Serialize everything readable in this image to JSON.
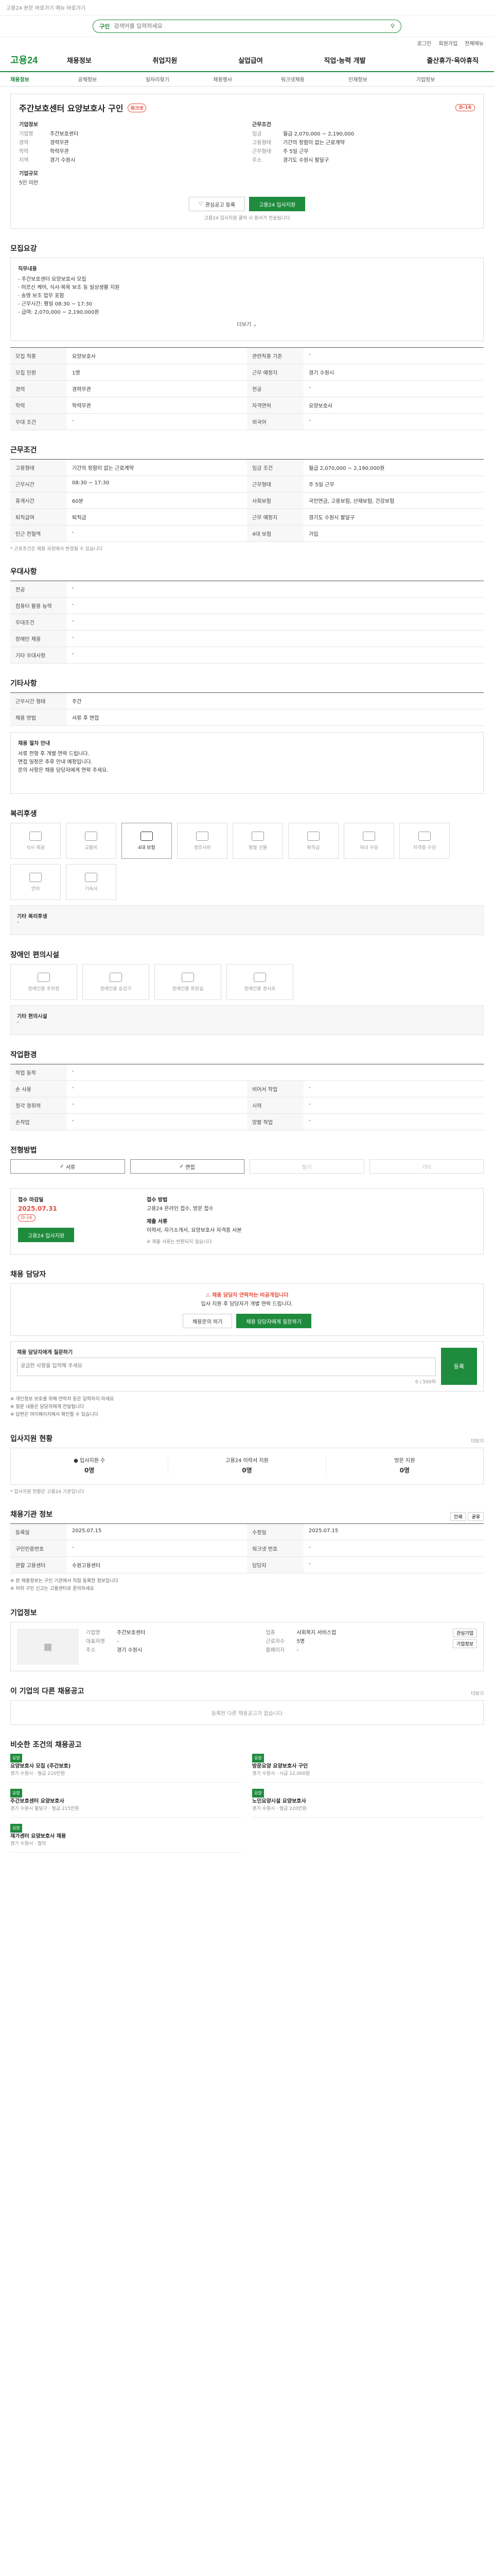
{
  "top": {
    "notice": "고용24 본문 바로가기 메뉴 바로가기"
  },
  "search": {
    "label": "구인",
    "placeholder": "검색어를 입력하세요"
  },
  "util": [
    "로그인",
    "회원가입",
    "전체메뉴"
  ],
  "brand": "고용24",
  "nav": [
    "채용정보",
    "취업지원",
    "실업급여",
    "직업·능력 개발",
    "출산휴가·육아휴직"
  ],
  "subnav": [
    "채용정보",
    "공채정보",
    "일자리찾기",
    "채용행사",
    "워크넷채용",
    "인재정보",
    "기업정보"
  ],
  "job": {
    "title": "주간보호센터 요양보호사 구인",
    "badge": "워크넷",
    "dday": "D-16",
    "company_label": "기업정보",
    "left": [
      [
        "기업명",
        "주간보호센터"
      ],
      [
        "경력",
        "경력무관"
      ],
      [
        "학력",
        "학력무관"
      ],
      [
        "지역",
        "경기 수원시"
      ]
    ],
    "right_label": "근무조건",
    "right": [
      [
        "임금",
        "월급 2,070,000 ~ 2,190,000"
      ],
      [
        "고용형태",
        "기간의 정함이 없는 근로계약"
      ],
      [
        "근무형태",
        "주 5일 근무"
      ],
      [
        "주소",
        "경기도 수원시 팔달구"
      ]
    ],
    "extra_label": "기업규모",
    "extra_value": "5인 미만",
    "btn_save": "관심공고 등록",
    "btn_apply": "고용24 입사지원",
    "note": "고용24 입사지원 클릭 시 원서가 전송됩니다"
  },
  "req": {
    "title": "모집요강",
    "duty_label": "직무내용",
    "duties": [
      "- 주간보호센터 요양보호사 모집",
      "· 어르신 케어, 식사·목욕 보조 등 일상생활 지원",
      "· 송영 보조 업무 포함",
      "- 근무시간: 평일 08:30 ~ 17:30",
      "- 급여: 2,070,000 ~ 2,190,000원"
    ],
    "more": "더보기",
    "rows": [
      [
        "모집 직종",
        "요양보호사",
        "관련직종 기준",
        "-"
      ],
      [
        "모집 인원",
        "1명",
        "근무 예정지",
        "경기 수원시"
      ],
      [
        "경력",
        "경력무관",
        "전공",
        "-"
      ],
      [
        "학력",
        "학력무관",
        "자격면허",
        "요양보호사"
      ],
      [
        "우대 조건",
        "-",
        "외국어",
        "-"
      ]
    ]
  },
  "work": {
    "title": "근무조건",
    "rows": [
      [
        "고용형태",
        "기간의 정함이 없는 근로계약",
        "임금 조건",
        "월급 2,070,000 ~ 2,190,000원"
      ],
      [
        "근무시간",
        "08:30 ~ 17:30",
        "근무형태",
        "주 5일 근무"
      ],
      [
        "휴게시간",
        "60분",
        "사회보험",
        "국민연금, 고용보험, 산재보험, 건강보험"
      ],
      [
        "퇴직급여",
        "퇴직금",
        "근무 예정지",
        "경기도 수원시 팔달구"
      ],
      [
        "인근 전철역",
        "-",
        "4대 보험",
        "가입"
      ]
    ],
    "note": "* 근로조건은 채용 과정에서 변경될 수 있습니다"
  },
  "welfare": {
    "title": "우대사항",
    "rows": [
      [
        "전공",
        "-"
      ],
      [
        "컴퓨터 활용 능력",
        "-"
      ],
      [
        "우대조건",
        "-"
      ],
      [
        "장애인 채용",
        "-"
      ],
      [
        "기타 우대사항",
        "-"
      ]
    ]
  },
  "process": {
    "title": "기타사항",
    "rows": [
      [
        "근무시간 형태",
        "주간"
      ],
      [
        "채용 방법",
        "서류 후 면접"
      ]
    ],
    "box_title": "채용 절차 안내",
    "box_lines": [
      "서류 전형 후 개별 연락 드립니다.",
      "면접 일정은 추후 안내 예정입니다.",
      "문의 사항은 채용 담당자에게 연락 주세요."
    ]
  },
  "benefits": {
    "title": "복리후생",
    "items": [
      "식사 제공",
      "교통비",
      "4대 보험",
      "경조사비",
      "명절 선물",
      "퇴직금",
      "자녀 수당",
      "자격증 수당",
      "연차",
      "기숙사"
    ],
    "active": [
      2
    ],
    "other_label": "기타 복리후생",
    "other_value": "-"
  },
  "disabled": {
    "title": "장애인 편의시설",
    "items": [
      "장애인용 주차장",
      "장애인용 승강기",
      "장애인용 화장실",
      "장애인용 경사로"
    ],
    "other_label": "기타 편의시설",
    "other_value": "-"
  },
  "env": {
    "title": "작업환경",
    "rows": [
      [
        "작업 동작",
        "-",
        "",
        ""
      ],
      [
        "손 사용",
        "-",
        "비어서 작업",
        "-"
      ],
      [
        "청각 청취력",
        "-",
        "시력",
        "-"
      ],
      [
        "손작업",
        "-",
        "양팔 작업",
        "-"
      ]
    ]
  },
  "selection": {
    "title": "전형방법",
    "tabs": [
      "서류",
      "면접",
      "필기",
      "기타"
    ],
    "active": [
      0,
      1
    ]
  },
  "apply": {
    "deadline_label": "접수 마감일",
    "deadline": "2025.07.31",
    "dday": "D-16",
    "btn": "고용24 입사지원",
    "method_label": "접수 방법",
    "method": "고용24 온라인 접수, 방문 접수",
    "docs_label": "제출 서류",
    "docs": "이력서, 자기소개서, 요양보호사 자격증 사본",
    "note": "※ 제출 서류는 반환되지 않습니다"
  },
  "contact": {
    "title": "채용 담당자",
    "warn": "채용 담당자 연락처는 비공개입니다",
    "text": "입사 지원 후 담당자가 개별 연락 드립니다.",
    "btn1": "채용문의 하기",
    "btn2": "채용 담당자에게 질문하기"
  },
  "inquiry": {
    "label": "채용 담당자에게 질문하기",
    "placeholder": "궁금한 사항을 입력해 주세요",
    "submit": "등록",
    "counter": "0 / 500자",
    "bullets": [
      "※ 개인정보 보호를 위해 연락처 등은 입력하지 마세요",
      "※ 질문 내용은 담당자에게 전달됩니다",
      "※ 답변은 마이페이지에서 확인할 수 있습니다"
    ]
  },
  "stats": {
    "title": "입사지원 현황",
    "more": "더보기",
    "items": [
      [
        "입사지원 수",
        "0명"
      ],
      [
        "고용24 이력서 지원",
        "0명"
      ],
      [
        "방문 지원",
        "0명"
      ]
    ],
    "note": "* 입사지원 현황은 고용24 기준입니다"
  },
  "meta": {
    "title": "채용기관 정보",
    "btns": [
      "인쇄",
      "공유"
    ],
    "rows": [
      [
        "등록일",
        "2025.07.15",
        "수정일",
        "2025.07.15"
      ],
      [
        "구인인증번호",
        "-",
        "워크넷 번호",
        "-"
      ],
      [
        "관할 고용센터",
        "수원고용센터",
        "담당자",
        "-"
      ]
    ],
    "notes": [
      "※ 본 채용정보는 구인 기관에서 직접 등록한 정보입니다",
      "※ 허위 구인 신고는 고용센터로 문의하세요"
    ]
  },
  "company": {
    "title": "기업정보",
    "rows": [
      [
        "기업명",
        "주간보호센터",
        "업종",
        "사회복지 서비스업"
      ],
      [
        "대표자명",
        "-",
        "근로자수",
        "5명"
      ],
      [
        "주소",
        "경기 수원시",
        "홈페이지",
        "-"
      ]
    ],
    "btns": [
      "관심기업",
      "기업정보"
    ]
  },
  "others": {
    "title": "이 기업의 다른 채용공고",
    "more": "더보기",
    "empty": "등록된 다른 채용공고가 없습니다"
  },
  "similar": {
    "title": "비슷한 조건의 채용공고",
    "jobs": [
      {
        "tag": "요양",
        "title": "요양보호사 모집 (주간보호)",
        "info": "경기 수원시 · 월급 210만원"
      },
      {
        "tag": "요양",
        "title": "방문요양 요양보호사 구인",
        "info": "경기 수원시 · 시급 12,000원"
      },
      {
        "tag": "요양",
        "title": "주간보호센터 요양보호사",
        "info": "경기 수원시 팔달구 · 월급 215만원"
      },
      {
        "tag": "요양",
        "title": "노인요양시설 요양보호사",
        "info": "경기 수원시 · 월급 220만원"
      },
      {
        "tag": "요양",
        "title": "재가센터 요양보호사 채용",
        "info": "경기 수원시 · 협의"
      }
    ]
  },
  "colors": {
    "accent": "#1e8b3d",
    "danger": "#e74c3c"
  }
}
